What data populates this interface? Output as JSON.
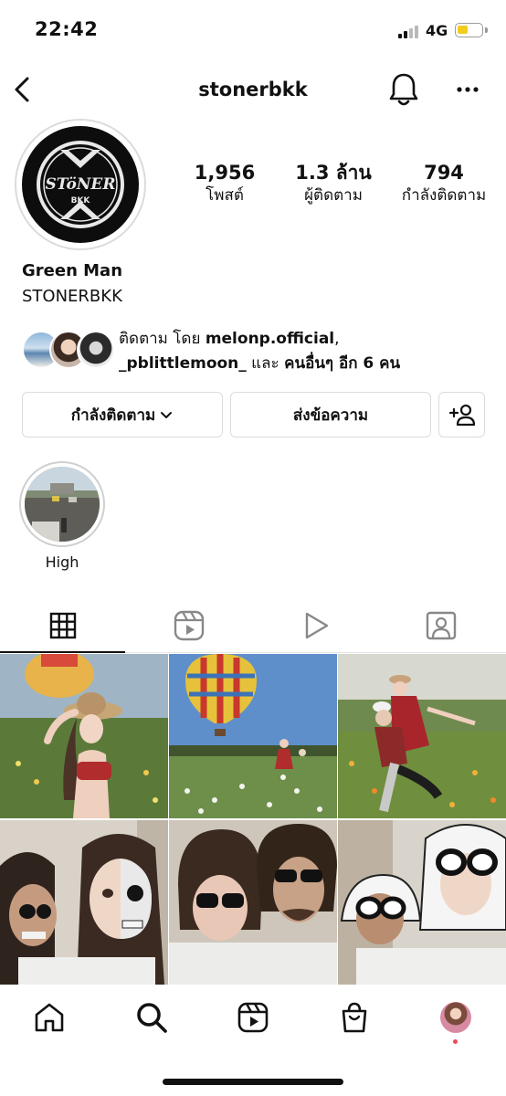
{
  "status_bar": {
    "time": "22:42",
    "network": "4G",
    "battery_color": "#f2cc1c"
  },
  "header": {
    "username": "stonerbkk"
  },
  "profile": {
    "avatar_logo": {
      "line1": "STöNER",
      "line2": "BKK"
    },
    "stats": [
      {
        "value": "1,956",
        "label": "โพสต์"
      },
      {
        "value": "1.3 ล้าน",
        "label": "ผู้ติดตาม"
      },
      {
        "value": "794",
        "label": "กำลังติดตาม"
      }
    ],
    "display_name": "Green Man",
    "bio": "STONERBKK",
    "followed_by": {
      "prefix": "ติดตาม โดย ",
      "user1": "melonp.official",
      "sep": ",",
      "user2": "_pblittlemoon_",
      "and": " และ ",
      "others": "คนอื่นๆ อีก 6 คน"
    }
  },
  "actions": {
    "following_label": "กำลังติดตาม",
    "message_label": "ส่งข้อความ"
  },
  "highlights": [
    {
      "label": "High"
    }
  ],
  "tabs": [
    {
      "icon": "grid-icon",
      "active": true
    },
    {
      "icon": "reels-icon",
      "active": false
    },
    {
      "icon": "video-play-icon",
      "active": false
    },
    {
      "icon": "tagged-icon",
      "active": false
    }
  ],
  "posts": [
    {
      "scene": "woman-hat-flower-field"
    },
    {
      "scene": "hot-air-balloon-field"
    },
    {
      "scene": "couple-flower-field"
    },
    {
      "scene": "skull-facepaint-selfie"
    },
    {
      "scene": "sunglasses-wig-selfie"
    },
    {
      "scene": "headscarf-sunglasses-selfie"
    }
  ],
  "bottom_nav": [
    {
      "icon": "home-icon"
    },
    {
      "icon": "search-icon"
    },
    {
      "icon": "reels-icon"
    },
    {
      "icon": "shop-icon"
    },
    {
      "icon": "profile-avatar"
    }
  ],
  "colors": {
    "notification_dot": "#ed4956",
    "border": "#dbdbdb"
  }
}
